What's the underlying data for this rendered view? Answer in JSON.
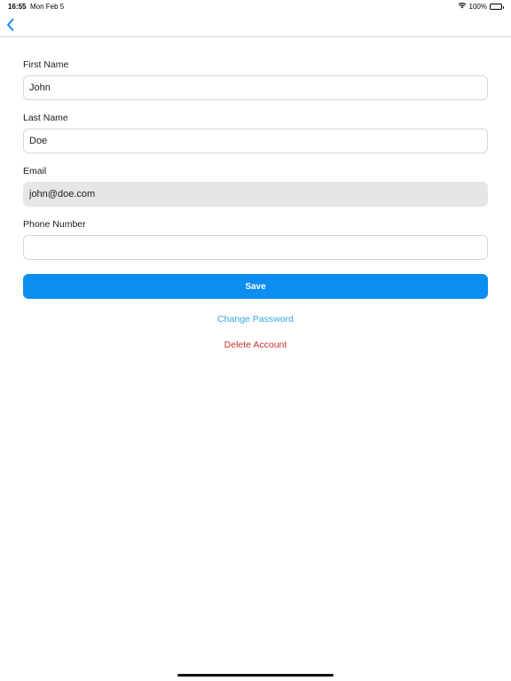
{
  "status_bar": {
    "time": "16:55",
    "date": "Mon Feb 5",
    "battery": "100%",
    "wifi_icon": "wifi-icon",
    "battery_icon": "battery-icon"
  },
  "nav": {
    "back_icon": "chevron-left-icon"
  },
  "form": {
    "first_name": {
      "label": "First Name",
      "value": "John"
    },
    "last_name": {
      "label": "Last Name",
      "value": "Doe"
    },
    "email": {
      "label": "Email",
      "value": "john@doe.com"
    },
    "phone": {
      "label": "Phone Number",
      "value": ""
    }
  },
  "actions": {
    "save_label": "Save",
    "change_password_label": "Change Password",
    "delete_account_label": "Delete Account"
  },
  "colors": {
    "accent": "#0c8ef1",
    "link": "#3ba4df",
    "danger": "#c3322d",
    "disabled_field": "#e6e6e8"
  }
}
